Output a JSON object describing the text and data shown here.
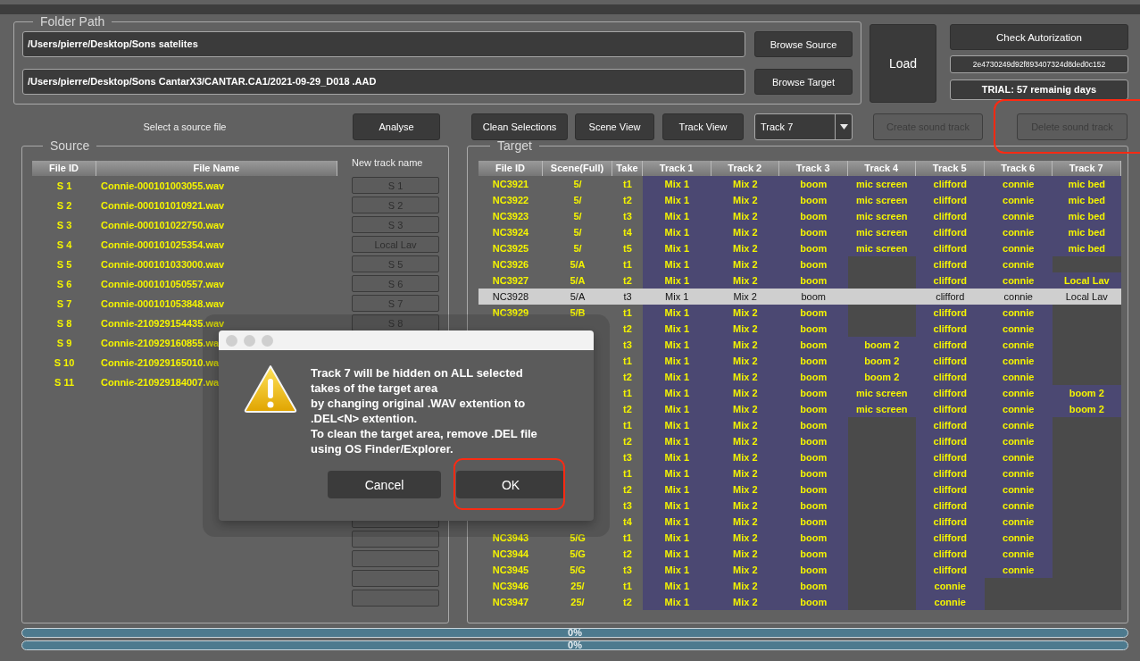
{
  "folder_path": {
    "title": "Folder Path",
    "source_path": "/Users/pierre/Desktop/Sons satelites",
    "target_path": "/Users/pierre/Desktop/Sons CantarX3/CANTAR.CA1/2021-09-29_D018 .AAD",
    "browse_source": "Browse Source",
    "browse_target": "Browse Target"
  },
  "load_button": "Load",
  "authorization": {
    "button": "Check Autorization",
    "key": "2e4730249d92f893407324d8ded0c152",
    "trial": "TRIAL: 57 remainig days"
  },
  "toolbar": {
    "items": [
      {
        "kind": "label",
        "label": "Select a source file"
      },
      {
        "kind": "button",
        "label": "Analyse",
        "disabled": false,
        "highlighted": false
      },
      {
        "kind": "button",
        "label": "Clean Selections",
        "disabled": false,
        "highlighted": false
      },
      {
        "kind": "button",
        "label": "Scene View",
        "disabled": false,
        "highlighted": false
      },
      {
        "kind": "button",
        "label": "Track View",
        "disabled": false,
        "highlighted": false
      },
      {
        "kind": "dropdown",
        "label": "Track 7"
      },
      {
        "kind": "button",
        "label": "Create sound track",
        "disabled": true,
        "highlighted": false
      },
      {
        "kind": "button",
        "label": "Delete sound track",
        "disabled": true,
        "highlighted": true
      }
    ]
  },
  "source": {
    "title": "Source",
    "columns": [
      "File ID",
      "File Name"
    ],
    "new_track_heading": "New track name",
    "rows": [
      {
        "file_id": "S 1",
        "file_name": "Connie-000101003055.wav",
        "new_track_name": "S 1"
      },
      {
        "file_id": "S 2",
        "file_name": "Connie-000101010921.wav",
        "new_track_name": "S 2"
      },
      {
        "file_id": "S 3",
        "file_name": "Connie-000101022750.wav",
        "new_track_name": "S 3"
      },
      {
        "file_id": "S 4",
        "file_name": "Connie-000101025354.wav",
        "new_track_name": "Local Lav"
      },
      {
        "file_id": "S 5",
        "file_name": "Connie-000101033000.wav",
        "new_track_name": "S 5"
      },
      {
        "file_id": "S 6",
        "file_name": "Connie-000101050557.wav",
        "new_track_name": "S 6"
      },
      {
        "file_id": "S 7",
        "file_name": "Connie-000101053848.wav",
        "new_track_name": "S 7"
      },
      {
        "file_id": "S 8",
        "file_name": "Connie-210929154435.wav",
        "new_track_name": "S 8"
      },
      {
        "file_id": "S 9",
        "file_name": "Connie-210929160855.wa"
      },
      {
        "file_id": "S 10",
        "file_name": "Connie-210929165010.wa"
      },
      {
        "file_id": "S 11",
        "file_name": "Connie-210929184007.wa"
      }
    ]
  },
  "target": {
    "title": "Target",
    "columns": [
      "File ID",
      "Scene(Full)",
      "Take",
      "Track 1",
      "Track 2",
      "Track 3",
      "Track 4",
      "Track 5",
      "Track 6",
      "Track 7"
    ],
    "rows": [
      {
        "file_id": "NC3921",
        "scene": "5/",
        "take": "t1",
        "selected": false,
        "tracks": [
          {
            "kind": "name",
            "text": "Mix 1"
          },
          {
            "kind": "name",
            "text": "Mix 2"
          },
          {
            "kind": "name",
            "text": "boom"
          },
          {
            "kind": "name",
            "text": "mic screen"
          },
          {
            "kind": "name",
            "text": "clifford"
          },
          {
            "kind": "name",
            "text": "connie"
          },
          {
            "kind": "name",
            "text": "mic bed"
          }
        ]
      },
      {
        "file_id": "NC3922",
        "scene": "5/",
        "take": "t2",
        "selected": false,
        "tracks": [
          {
            "kind": "name",
            "text": "Mix 1"
          },
          {
            "kind": "name",
            "text": "Mix 2"
          },
          {
            "kind": "name",
            "text": "boom"
          },
          {
            "kind": "name",
            "text": "mic screen"
          },
          {
            "kind": "name",
            "text": "clifford"
          },
          {
            "kind": "name",
            "text": "connie"
          },
          {
            "kind": "name",
            "text": "mic bed"
          }
        ]
      },
      {
        "file_id": "NC3923",
        "scene": "5/",
        "take": "t3",
        "selected": false,
        "tracks": [
          {
            "kind": "name",
            "text": "Mix 1"
          },
          {
            "kind": "name",
            "text": "Mix 2"
          },
          {
            "kind": "name",
            "text": "boom"
          },
          {
            "kind": "name",
            "text": "mic screen"
          },
          {
            "kind": "name",
            "text": "clifford"
          },
          {
            "kind": "name",
            "text": "connie"
          },
          {
            "kind": "name",
            "text": "mic bed"
          }
        ]
      },
      {
        "file_id": "NC3924",
        "scene": "5/",
        "take": "t4",
        "selected": false,
        "tracks": [
          {
            "kind": "name",
            "text": "Mix 1"
          },
          {
            "kind": "name",
            "text": "Mix 2"
          },
          {
            "kind": "name",
            "text": "boom"
          },
          {
            "kind": "name",
            "text": "mic screen"
          },
          {
            "kind": "name",
            "text": "clifford"
          },
          {
            "kind": "name",
            "text": "connie"
          },
          {
            "kind": "name",
            "text": "mic bed"
          }
        ]
      },
      {
        "file_id": "NC3925",
        "scene": "5/",
        "take": "t5",
        "selected": false,
        "tracks": [
          {
            "kind": "name",
            "text": "Mix 1"
          },
          {
            "kind": "name",
            "text": "Mix 2"
          },
          {
            "kind": "name",
            "text": "boom"
          },
          {
            "kind": "name",
            "text": "mic screen"
          },
          {
            "kind": "name",
            "text": "clifford"
          },
          {
            "kind": "name",
            "text": "connie"
          },
          {
            "kind": "name",
            "text": "mic bed"
          }
        ]
      },
      {
        "file_id": "NC3926",
        "scene": "5/A",
        "take": "t1",
        "selected": false,
        "tracks": [
          {
            "kind": "name",
            "text": "Mix 1"
          },
          {
            "kind": "name",
            "text": "Mix 2"
          },
          {
            "kind": "name",
            "text": "boom"
          },
          {
            "kind": "empty"
          },
          {
            "kind": "name",
            "text": "clifford"
          },
          {
            "kind": "name",
            "text": "connie"
          },
          {
            "kind": "empty"
          }
        ]
      },
      {
        "file_id": "NC3927",
        "scene": "5/A",
        "take": "t2",
        "selected": false,
        "tracks": [
          {
            "kind": "name",
            "text": "Mix 1"
          },
          {
            "kind": "name",
            "text": "Mix 2"
          },
          {
            "kind": "name",
            "text": "boom"
          },
          {
            "kind": "empty"
          },
          {
            "kind": "name",
            "text": "clifford"
          },
          {
            "kind": "name",
            "text": "connie"
          },
          {
            "kind": "name",
            "text": "Local Lav"
          }
        ]
      },
      {
        "file_id": "NC3928",
        "scene": "5/A",
        "take": "t3",
        "selected": true,
        "tracks": [
          {
            "kind": "name",
            "text": "Mix 1"
          },
          {
            "kind": "name",
            "text": "Mix 2"
          },
          {
            "kind": "name",
            "text": "boom"
          },
          {
            "kind": "empty"
          },
          {
            "kind": "name",
            "text": "clifford"
          },
          {
            "kind": "name",
            "text": "connie"
          },
          {
            "kind": "name",
            "text": "Local Lav"
          }
        ]
      },
      {
        "file_id": "NC3929",
        "scene": "5/B",
        "take": "t1",
        "selected": false,
        "tracks": [
          {
            "kind": "name",
            "text": "Mix 1"
          },
          {
            "kind": "name",
            "text": "Mix 2"
          },
          {
            "kind": "name",
            "text": "boom"
          },
          {
            "kind": "empty"
          },
          {
            "kind": "name",
            "text": "clifford"
          },
          {
            "kind": "name",
            "text": "connie"
          },
          {
            "kind": "empty"
          }
        ]
      },
      {
        "take": "t2",
        "selected": false,
        "tracks": [
          {
            "kind": "name",
            "text": "Mix 1"
          },
          {
            "kind": "name",
            "text": "Mix 2"
          },
          {
            "kind": "name",
            "text": "boom"
          },
          {
            "kind": "empty"
          },
          {
            "kind": "name",
            "text": "clifford"
          },
          {
            "kind": "name",
            "text": "connie"
          },
          {
            "kind": "empty"
          }
        ]
      },
      {
        "take": "t3",
        "selected": false,
        "tracks": [
          {
            "kind": "name",
            "text": "Mix 1"
          },
          {
            "kind": "name",
            "text": "Mix 2"
          },
          {
            "kind": "name",
            "text": "boom"
          },
          {
            "kind": "name",
            "text": "boom 2"
          },
          {
            "kind": "name",
            "text": "clifford"
          },
          {
            "kind": "name",
            "text": "connie"
          },
          {
            "kind": "empty"
          }
        ]
      },
      {
        "take": "t1",
        "selected": false,
        "tracks": [
          {
            "kind": "name",
            "text": "Mix 1"
          },
          {
            "kind": "name",
            "text": "Mix 2"
          },
          {
            "kind": "name",
            "text": "boom"
          },
          {
            "kind": "name",
            "text": "boom 2"
          },
          {
            "kind": "name",
            "text": "clifford"
          },
          {
            "kind": "name",
            "text": "connie"
          },
          {
            "kind": "empty"
          }
        ]
      },
      {
        "take": "t2",
        "selected": false,
        "tracks": [
          {
            "kind": "name",
            "text": "Mix 1"
          },
          {
            "kind": "name",
            "text": "Mix 2"
          },
          {
            "kind": "name",
            "text": "boom"
          },
          {
            "kind": "name",
            "text": "boom 2"
          },
          {
            "kind": "name",
            "text": "clifford"
          },
          {
            "kind": "name",
            "text": "connie"
          },
          {
            "kind": "empty"
          }
        ]
      },
      {
        "take": "t1",
        "selected": false,
        "tracks": [
          {
            "kind": "name",
            "text": "Mix 1"
          },
          {
            "kind": "name",
            "text": "Mix 2"
          },
          {
            "kind": "name",
            "text": "boom"
          },
          {
            "kind": "name",
            "text": "mic screen"
          },
          {
            "kind": "name",
            "text": "clifford"
          },
          {
            "kind": "name",
            "text": "connie"
          },
          {
            "kind": "name",
            "text": "boom 2"
          }
        ]
      },
      {
        "take": "t2",
        "selected": false,
        "tracks": [
          {
            "kind": "name",
            "text": "Mix 1"
          },
          {
            "kind": "name",
            "text": "Mix 2"
          },
          {
            "kind": "name",
            "text": "boom"
          },
          {
            "kind": "name",
            "text": "mic screen"
          },
          {
            "kind": "name",
            "text": "clifford"
          },
          {
            "kind": "name",
            "text": "connie"
          },
          {
            "kind": "name",
            "text": "boom 2"
          }
        ]
      },
      {
        "take": "t1",
        "selected": false,
        "tracks": [
          {
            "kind": "name",
            "text": "Mix 1"
          },
          {
            "kind": "name",
            "text": "Mix 2"
          },
          {
            "kind": "name",
            "text": "boom"
          },
          {
            "kind": "empty"
          },
          {
            "kind": "name",
            "text": "clifford"
          },
          {
            "kind": "name",
            "text": "connie"
          },
          {
            "kind": "empty"
          }
        ]
      },
      {
        "take": "t2",
        "selected": false,
        "tracks": [
          {
            "kind": "name",
            "text": "Mix 1"
          },
          {
            "kind": "name",
            "text": "Mix 2"
          },
          {
            "kind": "name",
            "text": "boom"
          },
          {
            "kind": "empty"
          },
          {
            "kind": "name",
            "text": "clifford"
          },
          {
            "kind": "name",
            "text": "connie"
          },
          {
            "kind": "empty"
          }
        ]
      },
      {
        "take": "t3",
        "selected": false,
        "tracks": [
          {
            "kind": "name",
            "text": "Mix 1"
          },
          {
            "kind": "name",
            "text": "Mix 2"
          },
          {
            "kind": "name",
            "text": "boom"
          },
          {
            "kind": "empty"
          },
          {
            "kind": "name",
            "text": "clifford"
          },
          {
            "kind": "name",
            "text": "connie"
          },
          {
            "kind": "empty"
          }
        ]
      },
      {
        "take": "t1",
        "selected": false,
        "tracks": [
          {
            "kind": "name",
            "text": "Mix 1"
          },
          {
            "kind": "name",
            "text": "Mix 2"
          },
          {
            "kind": "name",
            "text": "boom"
          },
          {
            "kind": "empty"
          },
          {
            "kind": "name",
            "text": "clifford"
          },
          {
            "kind": "name",
            "text": "connie"
          },
          {
            "kind": "empty"
          }
        ]
      },
      {
        "take": "t2",
        "selected": false,
        "tracks": [
          {
            "kind": "name",
            "text": "Mix 1"
          },
          {
            "kind": "name",
            "text": "Mix 2"
          },
          {
            "kind": "name",
            "text": "boom"
          },
          {
            "kind": "empty"
          },
          {
            "kind": "name",
            "text": "clifford"
          },
          {
            "kind": "name",
            "text": "connie"
          },
          {
            "kind": "empty"
          }
        ]
      },
      {
        "take": "t3",
        "selected": false,
        "tracks": [
          {
            "kind": "name",
            "text": "Mix 1"
          },
          {
            "kind": "name",
            "text": "Mix 2"
          },
          {
            "kind": "name",
            "text": "boom"
          },
          {
            "kind": "empty"
          },
          {
            "kind": "name",
            "text": "clifford"
          },
          {
            "kind": "name",
            "text": "connie"
          },
          {
            "kind": "empty"
          }
        ]
      },
      {
        "take": "t4",
        "selected": false,
        "tracks": [
          {
            "kind": "name",
            "text": "Mix 1"
          },
          {
            "kind": "name",
            "text": "Mix 2"
          },
          {
            "kind": "name",
            "text": "boom"
          },
          {
            "kind": "empty"
          },
          {
            "kind": "name",
            "text": "clifford"
          },
          {
            "kind": "name",
            "text": "connie"
          },
          {
            "kind": "empty"
          }
        ]
      },
      {
        "file_id": "NC3943",
        "scene": "5/G",
        "take": "t1",
        "selected": false,
        "tracks": [
          {
            "kind": "name",
            "text": "Mix 1"
          },
          {
            "kind": "name",
            "text": "Mix 2"
          },
          {
            "kind": "name",
            "text": "boom"
          },
          {
            "kind": "empty"
          },
          {
            "kind": "name",
            "text": "clifford"
          },
          {
            "kind": "name",
            "text": "connie"
          },
          {
            "kind": "empty"
          }
        ]
      },
      {
        "file_id": "NC3944",
        "scene": "5/G",
        "take": "t2",
        "selected": false,
        "tracks": [
          {
            "kind": "name",
            "text": "Mix 1"
          },
          {
            "kind": "name",
            "text": "Mix 2"
          },
          {
            "kind": "name",
            "text": "boom"
          },
          {
            "kind": "empty"
          },
          {
            "kind": "name",
            "text": "clifford"
          },
          {
            "kind": "name",
            "text": "connie"
          },
          {
            "kind": "empty"
          }
        ]
      },
      {
        "file_id": "NC3945",
        "scene": "5/G",
        "take": "t3",
        "selected": false,
        "tracks": [
          {
            "kind": "name",
            "text": "Mix 1"
          },
          {
            "kind": "name",
            "text": "Mix 2"
          },
          {
            "kind": "name",
            "text": "boom"
          },
          {
            "kind": "empty"
          },
          {
            "kind": "name",
            "text": "clifford"
          },
          {
            "kind": "name",
            "text": "connie"
          },
          {
            "kind": "empty"
          }
        ]
      },
      {
        "file_id": "NC3946",
        "scene": "25/",
        "take": "t1",
        "selected": false,
        "tracks": [
          {
            "kind": "name",
            "text": "Mix 1"
          },
          {
            "kind": "name",
            "text": "Mix 2"
          },
          {
            "kind": "name",
            "text": "boom"
          },
          {
            "kind": "empty"
          },
          {
            "kind": "name",
            "text": "connie"
          },
          {
            "kind": "empty"
          },
          {
            "kind": "empty"
          }
        ]
      },
      {
        "file_id": "NC3947",
        "scene": "25/",
        "take": "t2",
        "selected": false,
        "tracks": [
          {
            "kind": "name",
            "text": "Mix 1"
          },
          {
            "kind": "name",
            "text": "Mix 2"
          },
          {
            "kind": "name",
            "text": "boom"
          },
          {
            "kind": "empty"
          },
          {
            "kind": "name",
            "text": "connie"
          },
          {
            "kind": "empty"
          },
          {
            "kind": "empty"
          }
        ]
      }
    ]
  },
  "progress": [
    {
      "level": 0,
      "text": "0%"
    },
    {
      "level": 0,
      "text": "0%"
    }
  ],
  "dialog": {
    "message": "Track 7 will be hidden on ALL selected\ntakes of the target area\nby changing original .WAV extention to\n.DEL<N> extention.\nTo clean the target area, remove .DEL file\nusing OS Finder/Explorer.",
    "buttons": [
      {
        "label": "Cancel",
        "highlighted": false
      },
      {
        "label": "OK",
        "highlighted": true
      }
    ]
  }
}
